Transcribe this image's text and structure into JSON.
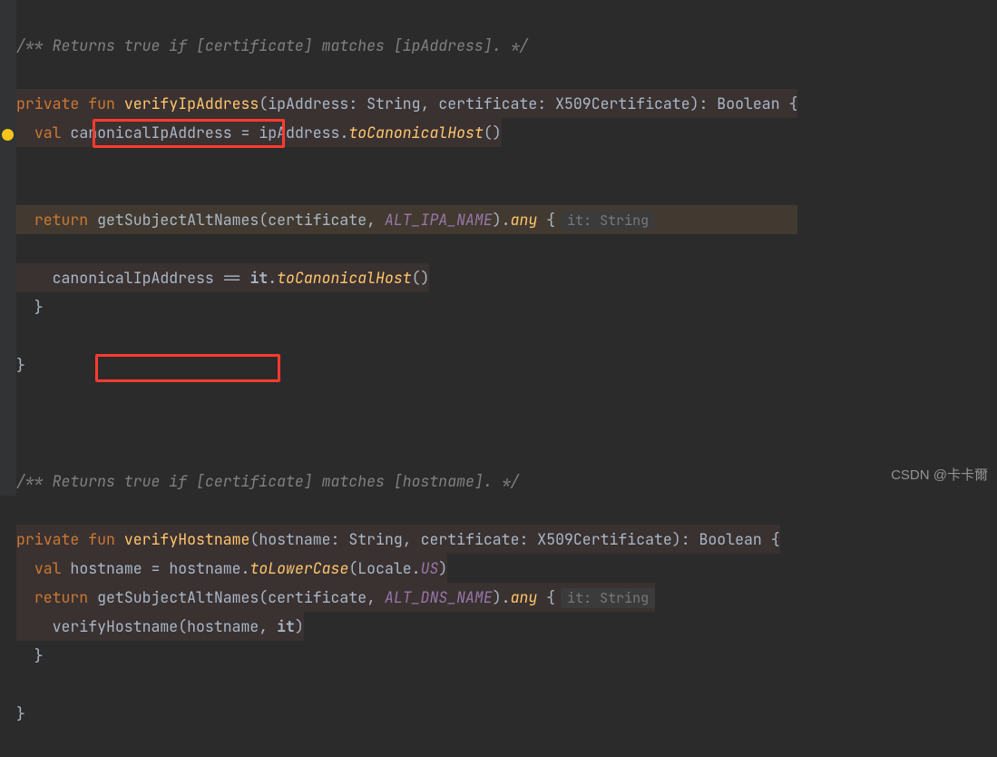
{
  "func1": {
    "comment_prefix": "/** Returns true if ",
    "comment_link1": "[certificate]",
    "comment_mid": " matches ",
    "comment_link2": "[ipAddress]",
    "comment_suffix": ". */",
    "kw_private": "private",
    "kw_fun": "fun",
    "name": "verifyIpAddress",
    "param1": "ipAddress",
    "ptype1": "String",
    "param2": "certificate",
    "ptype2": "X509Certificate",
    "rettype": "Boolean",
    "kw_val": "val",
    "local1": "canonicalIpAddress",
    "eq": "=",
    "use_param1": "ipAddress",
    "ext1": "toCanonicalHost",
    "kw_return": "return",
    "call": "getSubjectAltNames",
    "arg2": "certificate",
    "const": "ALT_IPA_NAME",
    "ext_any": "any",
    "hint": "it: String",
    "body_lhs": "canonicalIpAddress",
    "op": "==",
    "it": "it",
    "ext2": "toCanonicalHost"
  },
  "func2": {
    "comment_prefix": "/** Returns true if ",
    "comment_link1": "[certificate]",
    "comment_mid": " matches ",
    "comment_link2": "[hostname]",
    "comment_suffix": ". */",
    "kw_private": "private",
    "kw_fun": "fun",
    "name": "verifyHostname",
    "param1": "hostname",
    "ptype1": "String",
    "param2": "certificate",
    "ptype2": "X509Certificate",
    "rettype": "Boolean",
    "kw_val": "val",
    "local1": "hostname",
    "eq": "=",
    "use_param1": "hostname",
    "ext1": "toLowerCase",
    "locale": "Locale",
    "us": "US",
    "kw_return": "return",
    "call": "getSubjectAltNames",
    "arg2": "certificate",
    "const": "ALT_DNS_NAME",
    "ext_any": "any",
    "hint": "it: String",
    "inner_call": "verifyHostname",
    "inner_a1": "hostname",
    "it": "it"
  },
  "watermark": "CSDN @卡卡爾"
}
